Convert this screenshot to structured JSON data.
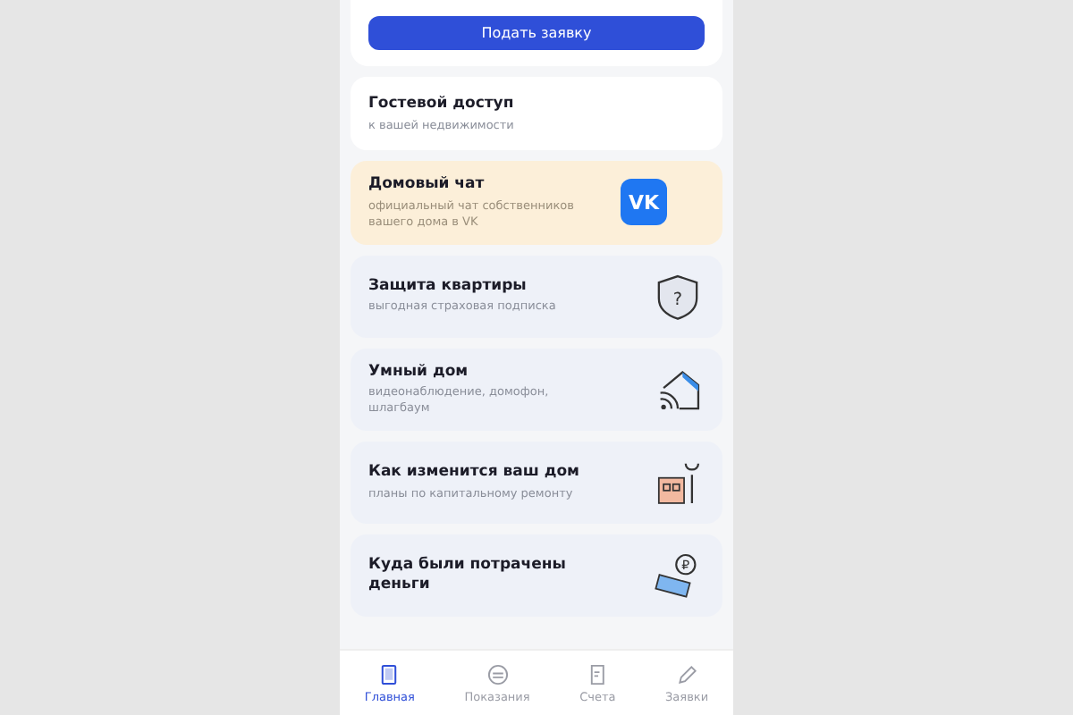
{
  "submit_button": "Подать заявку",
  "cards": [
    {
      "kind": "plain",
      "title": "Гостевой доступ",
      "subtitle": "к вашей недвижимости"
    },
    {
      "kind": "highlight",
      "title": "Домовый чат",
      "subtitle": "официальный чат собственников вашего дома в VK",
      "logo_text": "VK"
    },
    {
      "kind": "service",
      "title": "Защита квартиры",
      "subtitle": "выгодная страховая подписка",
      "icon_text": "?"
    },
    {
      "kind": "service",
      "title": "Умный дом",
      "subtitle": "видеонаблюдение, домофон, шлагбаум"
    },
    {
      "kind": "service",
      "title": "Как изменится ваш дом",
      "subtitle": "планы по капитальному ремонту"
    },
    {
      "kind": "service",
      "title": "Куда были потрачены деньги",
      "icon_text": "₽"
    }
  ],
  "nav": [
    {
      "label": "Главная",
      "selected": true
    },
    {
      "label": "Показания",
      "selected": false
    },
    {
      "label": "Счета",
      "selected": false
    },
    {
      "label": "Заявки",
      "selected": false
    }
  ]
}
